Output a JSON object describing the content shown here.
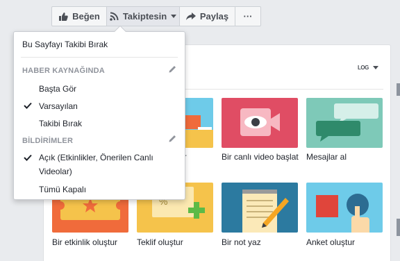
{
  "actionbar": {
    "like": "Beğen",
    "follow": "Takiptesin",
    "share": "Paylaş",
    "more": "···"
  },
  "card": {
    "log_button": "LOG"
  },
  "tiles": [
    {
      "label": "Bir canlı video başlat"
    },
    {
      "label": "Mesajlar al"
    },
    {
      "label": "Bir etkinlik oluştur"
    },
    {
      "label": "Teklif oluştur"
    },
    {
      "label": "Bir not yaz"
    },
    {
      "label": "Anket oluştur"
    },
    {
      "label": "ur"
    }
  ],
  "menu": {
    "unfollow": "Bu Sayfayı Takibi Bırak",
    "news_feed_header": "HABER KAYNAĞINDA",
    "see_first": "Başta Gör",
    "default": "Varsayılan",
    "unfollow_short": "Takibi Bırak",
    "notifications_header": "BİLDİRİMLER",
    "on_line1": "Açık (Etkinlikler, Önerilen Canlı",
    "on_line2": "Videolar)",
    "all_off": "Tümü Kapalı"
  },
  "colors": {
    "accent": "#4b4f56",
    "live_tile": "#e04d64",
    "messages_tile": "#7ec9b8",
    "event_tile": "#f06b3b",
    "offer_tile": "#f5c34b",
    "note_tile": "#2c7aa0",
    "poll_tile": "#6ecbe9"
  }
}
